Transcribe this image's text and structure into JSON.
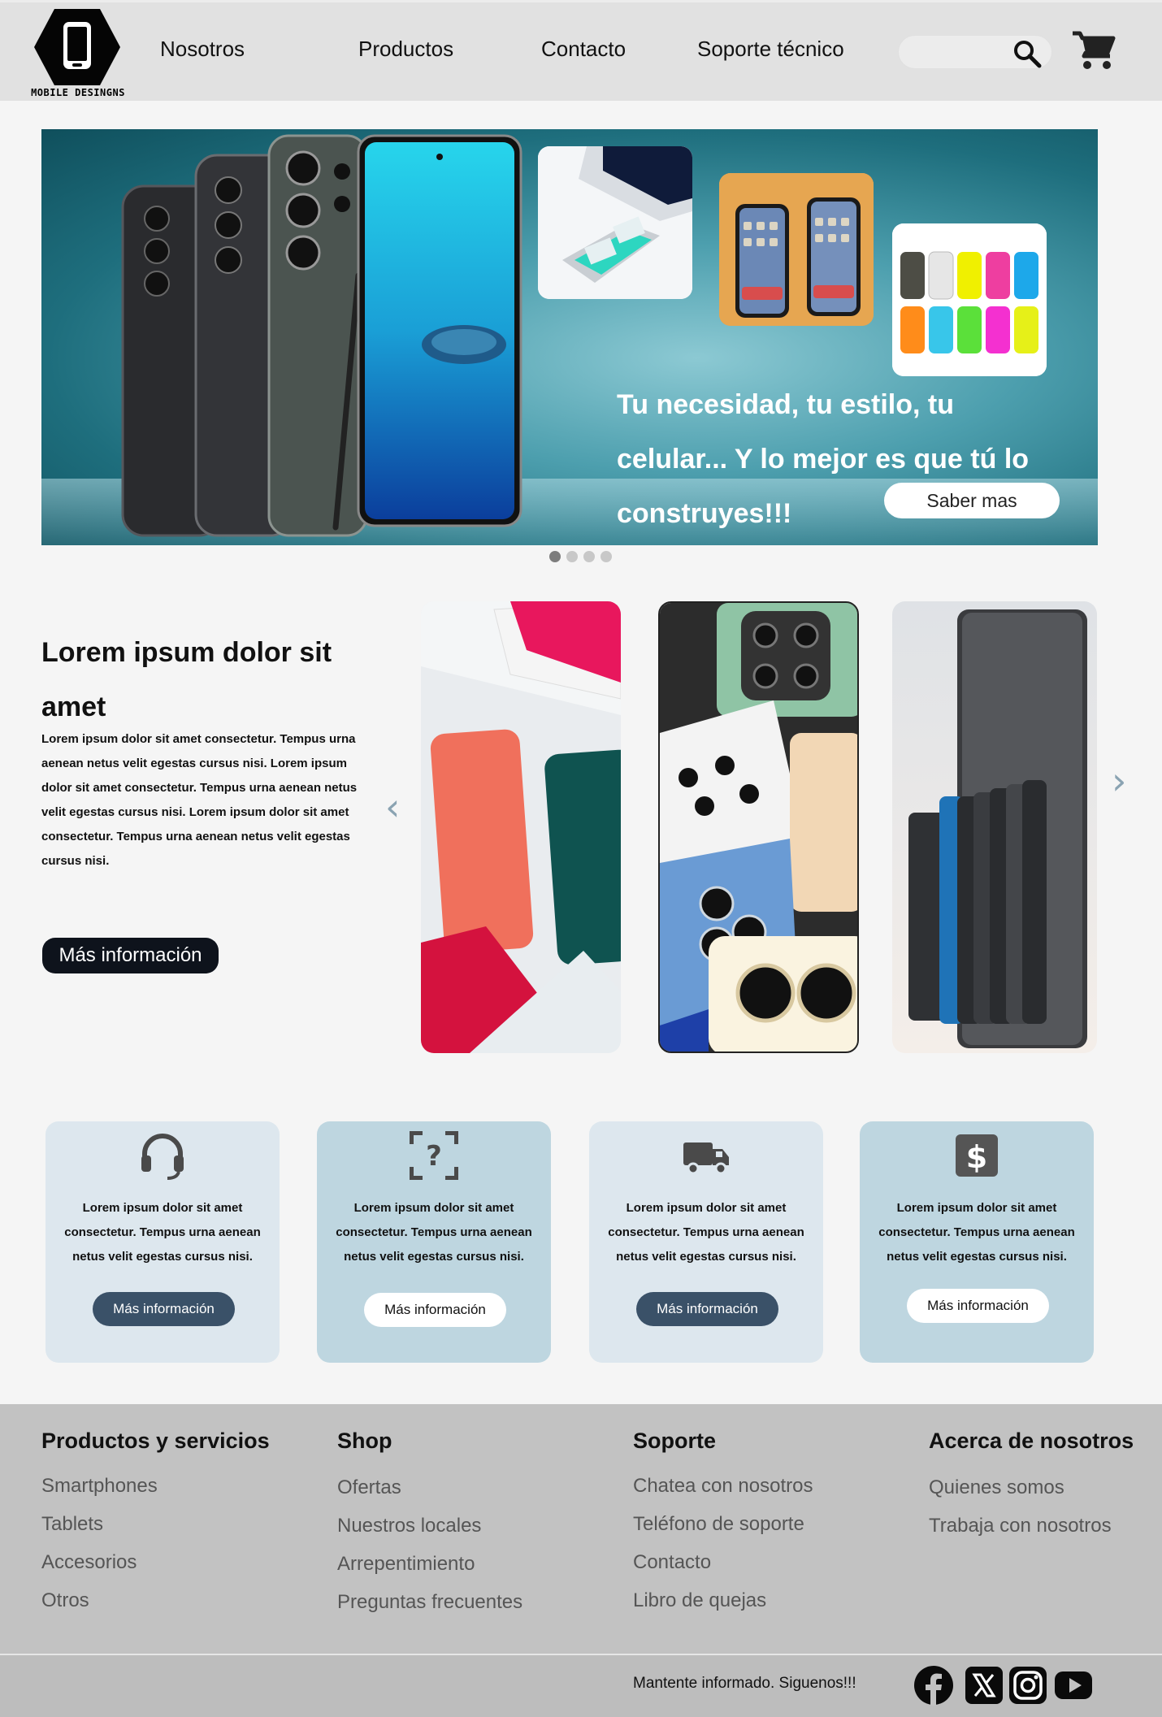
{
  "brand": {
    "logo_text": "MOBILE DESINGNS"
  },
  "nav": [
    {
      "label": "Nosotros"
    },
    {
      "label": "Productos"
    },
    {
      "label": "Contacto"
    },
    {
      "label": "Soporte técnico"
    }
  ],
  "search": {
    "placeholder": ""
  },
  "hero": {
    "headline": "Tu necesidad, tu estilo, tu celular... Y lo mejor es que tú lo construyes!!!",
    "button_label": "Saber mas",
    "active_slide": 1,
    "slide_count": 4
  },
  "info": {
    "title": "Lorem ipsum dolor sit amet",
    "body": "Lorem ipsum dolor sit amet consectetur. Tempus urna aenean netus velit egestas cursus nisi. Lorem ipsum dolor sit amet consectetur. Tempus urna aenean netus velit egestas cursus nisi. Lorem ipsum dolor sit amet consectetur. Tempus urna aenean netus velit egestas cursus nisi.",
    "button_label": "Más información",
    "prev_arrow": "‹",
    "next_arrow": "›"
  },
  "features": [
    {
      "icon": "headset-icon",
      "text": "Lorem ipsum dolor sit amet consectetur. Tempus urna aenean netus velit egestas cursus nisi.",
      "button_label": "Más información"
    },
    {
      "icon": "question-scan-icon",
      "text": "Lorem ipsum dolor sit amet consectetur. Tempus urna aenean netus velit egestas cursus nisi.",
      "button_label": "Más información"
    },
    {
      "icon": "delivery-truck-icon",
      "text": "Lorem ipsum dolor sit amet consectetur. Tempus urna aenean netus velit egestas cursus nisi.",
      "button_label": "Más información"
    },
    {
      "icon": "dollar-icon",
      "text": "Lorem ipsum dolor sit amet consectetur. Tempus urna aenean netus velit egestas cursus nisi.",
      "button_label": "Más información"
    }
  ],
  "footer": {
    "columns": [
      {
        "title": "Productos y servicios",
        "links": [
          "Smartphones",
          "Tablets",
          "Accesorios",
          "Otros"
        ]
      },
      {
        "title": "Shop",
        "links": [
          "Ofertas",
          "Nuestros locales",
          "Arrepentimiento",
          "Preguntas frecuentes"
        ]
      },
      {
        "title": "Soporte",
        "links": [
          "Chatea con nosotros",
          "Teléfono de soporte",
          "Contacto",
          "Libro de quejas"
        ]
      },
      {
        "title": "Acerca de nosotros",
        "links": [
          "Quienes somos",
          "Trabaja con nosotros"
        ]
      }
    ],
    "stay_informed": "Mantente informado. Siguenos!!!",
    "social": [
      "facebook-icon",
      "x-twitter-icon",
      "instagram-icon",
      "youtube-icon"
    ]
  },
  "colors": {
    "header_bg": "#e1e1e1",
    "footer_bg": "#c2c2c2",
    "card_light": "#dde7ee",
    "card_mid": "#bed6e0",
    "button_dark": "#3a5168",
    "hero_teal": "#1e6e7d"
  }
}
